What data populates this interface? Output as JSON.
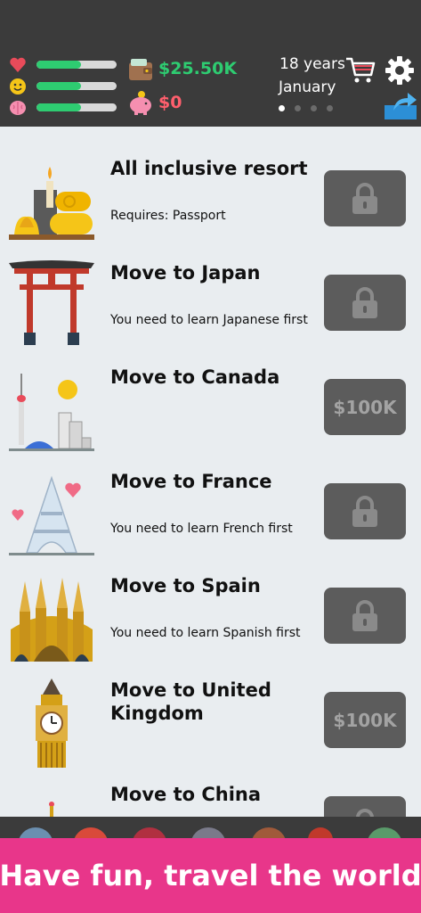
{
  "header": {
    "stats": [
      {
        "icon": "heart-icon",
        "level": 0.55
      },
      {
        "icon": "smile-icon",
        "level": 0.55
      },
      {
        "icon": "brain-icon",
        "level": 0.55
      }
    ],
    "cash": "$25.50K",
    "debt": "$0",
    "age": "18 years",
    "month": "January",
    "page_dots": 4,
    "active_dot": 0
  },
  "items": [
    {
      "title": "All inclusive resort",
      "subtitle": "Requires: Passport",
      "locked": true,
      "price": ""
    },
    {
      "title": "Move to Japan",
      "subtitle": "You need to learn Japanese first",
      "locked": true,
      "price": ""
    },
    {
      "title": "Move to Canada",
      "subtitle": "",
      "locked": false,
      "price": "$100K"
    },
    {
      "title": "Move to France",
      "subtitle": "You need to learn French first",
      "locked": true,
      "price": ""
    },
    {
      "title": "Move to Spain",
      "subtitle": "You need to learn Spanish first",
      "locked": true,
      "price": ""
    },
    {
      "title": "Move to United Kingdom",
      "subtitle": "",
      "locked": false,
      "price": "$100K"
    },
    {
      "title": "Move to China",
      "subtitle": "",
      "locked": true,
      "price": ""
    }
  ],
  "banner": {
    "text": "Have fun, travel the world"
  },
  "colors": {
    "accent": "#2ecc71",
    "debt": "#ff5f6d",
    "banner": "#e8368a",
    "header": "#3b3b3b"
  }
}
